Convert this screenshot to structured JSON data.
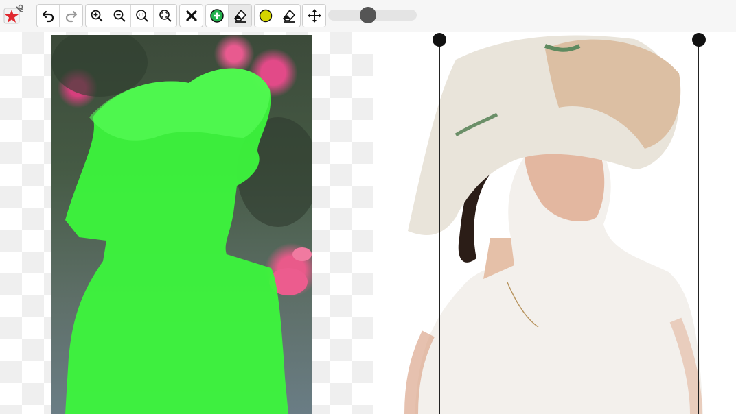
{
  "toolbar": {
    "logo_icon": "app-logo-icon",
    "history": [
      {
        "name": "undo-button",
        "icon": "undo-icon"
      },
      {
        "name": "redo-button",
        "icon": "redo-icon"
      }
    ],
    "zoom": [
      {
        "name": "zoom-in-button",
        "icon": "zoom-in-icon"
      },
      {
        "name": "zoom-out-button",
        "icon": "zoom-out-icon"
      },
      {
        "name": "zoom-actual-size-button",
        "icon": "zoom-actual-icon",
        "text": "1:1"
      },
      {
        "name": "zoom-fit-button",
        "icon": "zoom-fit-icon"
      }
    ],
    "clear": {
      "name": "clear-button",
      "icon": "close-icon"
    },
    "mask_tools": [
      {
        "name": "add-mask-button",
        "icon": "plus-circle-icon",
        "color": "#22b14c"
      },
      {
        "name": "erase-mask-button",
        "icon": "eraser-icon",
        "active": true
      }
    ],
    "color_tools": [
      {
        "name": "mark-color-button",
        "icon": "yellow-dot-icon",
        "color": "#d4d400"
      },
      {
        "name": "eraser-button",
        "icon": "eraser-icon"
      }
    ],
    "move": {
      "name": "move-button",
      "icon": "move-icon"
    },
    "brush_size": {
      "value": 0.45
    }
  },
  "colors": {
    "mask": "#3cf53c",
    "accent": "#22b14c",
    "yellow": "#d4d400",
    "handle": "#111111"
  }
}
